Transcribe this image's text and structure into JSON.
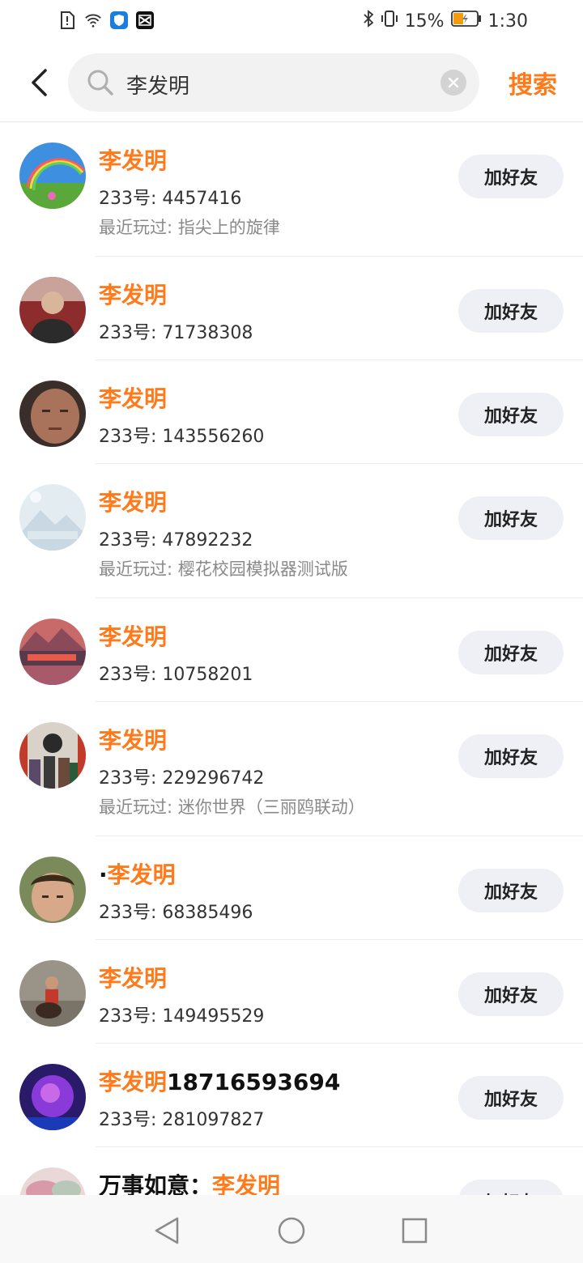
{
  "status_bar": {
    "battery": "15%",
    "time": "1:30",
    "icons": [
      "sim-alert-icon",
      "wifi-icon",
      "shield-app-icon",
      "capcut-app-icon",
      "bluetooth-icon",
      "vibrate-icon",
      "battery-icon"
    ]
  },
  "header": {
    "query": "李发明",
    "search_label": "搜索"
  },
  "results": [
    {
      "prefix": "",
      "name": "李发明",
      "suffix": "",
      "uid": "233号: 4457416",
      "played": "最近玩过: 指尖上的旋律",
      "button": "加好友"
    },
    {
      "prefix": "",
      "name": "李发明",
      "suffix": "",
      "uid": "233号: 71738308",
      "played": "",
      "button": "加好友"
    },
    {
      "prefix": "",
      "name": "李发明",
      "suffix": "",
      "uid": "233号: 143556260",
      "played": "",
      "button": "加好友"
    },
    {
      "prefix": "",
      "name": "李发明",
      "suffix": "",
      "uid": "233号: 47892232",
      "played": "最近玩过: 樱花校园模拟器测试版",
      "button": "加好友"
    },
    {
      "prefix": "",
      "name": "李发明",
      "suffix": "",
      "uid": "233号: 10758201",
      "played": "",
      "button": "加好友"
    },
    {
      "prefix": "",
      "name": "李发明",
      "suffix": "",
      "uid": "233号: 229296742",
      "played": "最近玩过: 迷你世界（三丽鸥联动）",
      "button": "加好友"
    },
    {
      "prefix": "·",
      "name": "李发明",
      "suffix": "",
      "uid": "233号: 68385496",
      "played": "",
      "button": "加好友"
    },
    {
      "prefix": "",
      "name": "李发明",
      "suffix": "",
      "uid": "233号: 149495529",
      "played": "",
      "button": "加好友"
    },
    {
      "prefix": "",
      "name": "李发明",
      "suffix": "18716593694",
      "uid": "233号: 281097827",
      "played": "",
      "button": "加好友"
    },
    {
      "prefix": "万事如意：",
      "name": "李发明",
      "suffix": "",
      "uid": "",
      "played": "",
      "button": "加好友"
    }
  ],
  "colors": {
    "highlight": "#ff7a1a",
    "button_bg": "#eef0f6"
  }
}
